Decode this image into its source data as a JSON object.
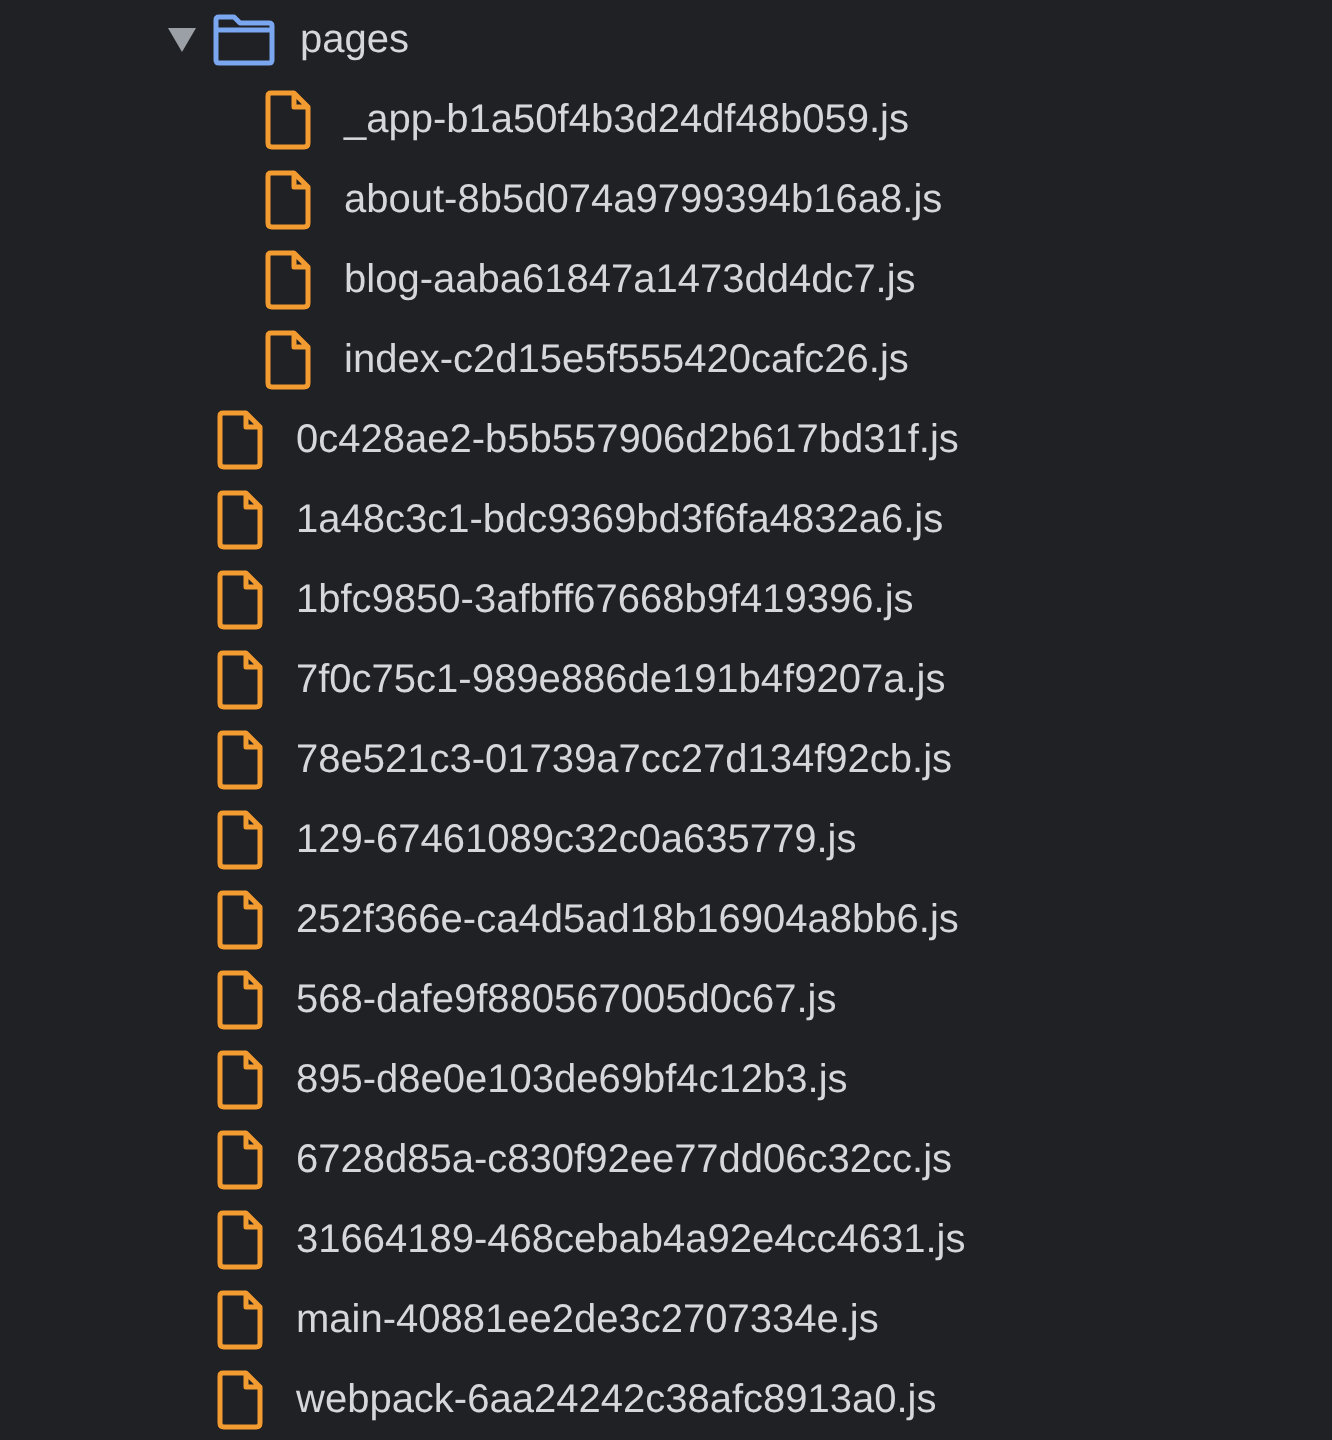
{
  "tree": [
    {
      "kind": "folder",
      "name": "pages",
      "expanded": true,
      "children": [
        {
          "kind": "file",
          "name": "_app-b1a50f4b3d24df48b059.js"
        },
        {
          "kind": "file",
          "name": "about-8b5d074a9799394b16a8.js"
        },
        {
          "kind": "file",
          "name": "blog-aaba61847a1473dd4dc7.js"
        },
        {
          "kind": "file",
          "name": "index-c2d15e5f555420cafc26.js"
        }
      ]
    },
    {
      "kind": "file",
      "name": "0c428ae2-b5b557906d2b617bd31f.js"
    },
    {
      "kind": "file",
      "name": "1a48c3c1-bdc9369bd3f6fa4832a6.js"
    },
    {
      "kind": "file",
      "name": "1bfc9850-3afbff67668b9f419396.js"
    },
    {
      "kind": "file",
      "name": "7f0c75c1-989e886de191b4f9207a.js"
    },
    {
      "kind": "file",
      "name": "78e521c3-01739a7cc27d134f92cb.js"
    },
    {
      "kind": "file",
      "name": "129-67461089c32c0a635779.js"
    },
    {
      "kind": "file",
      "name": "252f366e-ca4d5ad18b16904a8bb6.js"
    },
    {
      "kind": "file",
      "name": "568-dafe9f880567005d0c67.js"
    },
    {
      "kind": "file",
      "name": "895-d8e0e103de69bf4c12b3.js"
    },
    {
      "kind": "file",
      "name": "6728d85a-c830f92ee77dd06c32cc.js"
    },
    {
      "kind": "file",
      "name": "31664189-468cebab4a92e4cc4631.js"
    },
    {
      "kind": "file",
      "name": "main-40881ee2de3c2707334e.js"
    },
    {
      "kind": "file",
      "name": "webpack-6aa24242c38afc8913a0.js"
    }
  ]
}
